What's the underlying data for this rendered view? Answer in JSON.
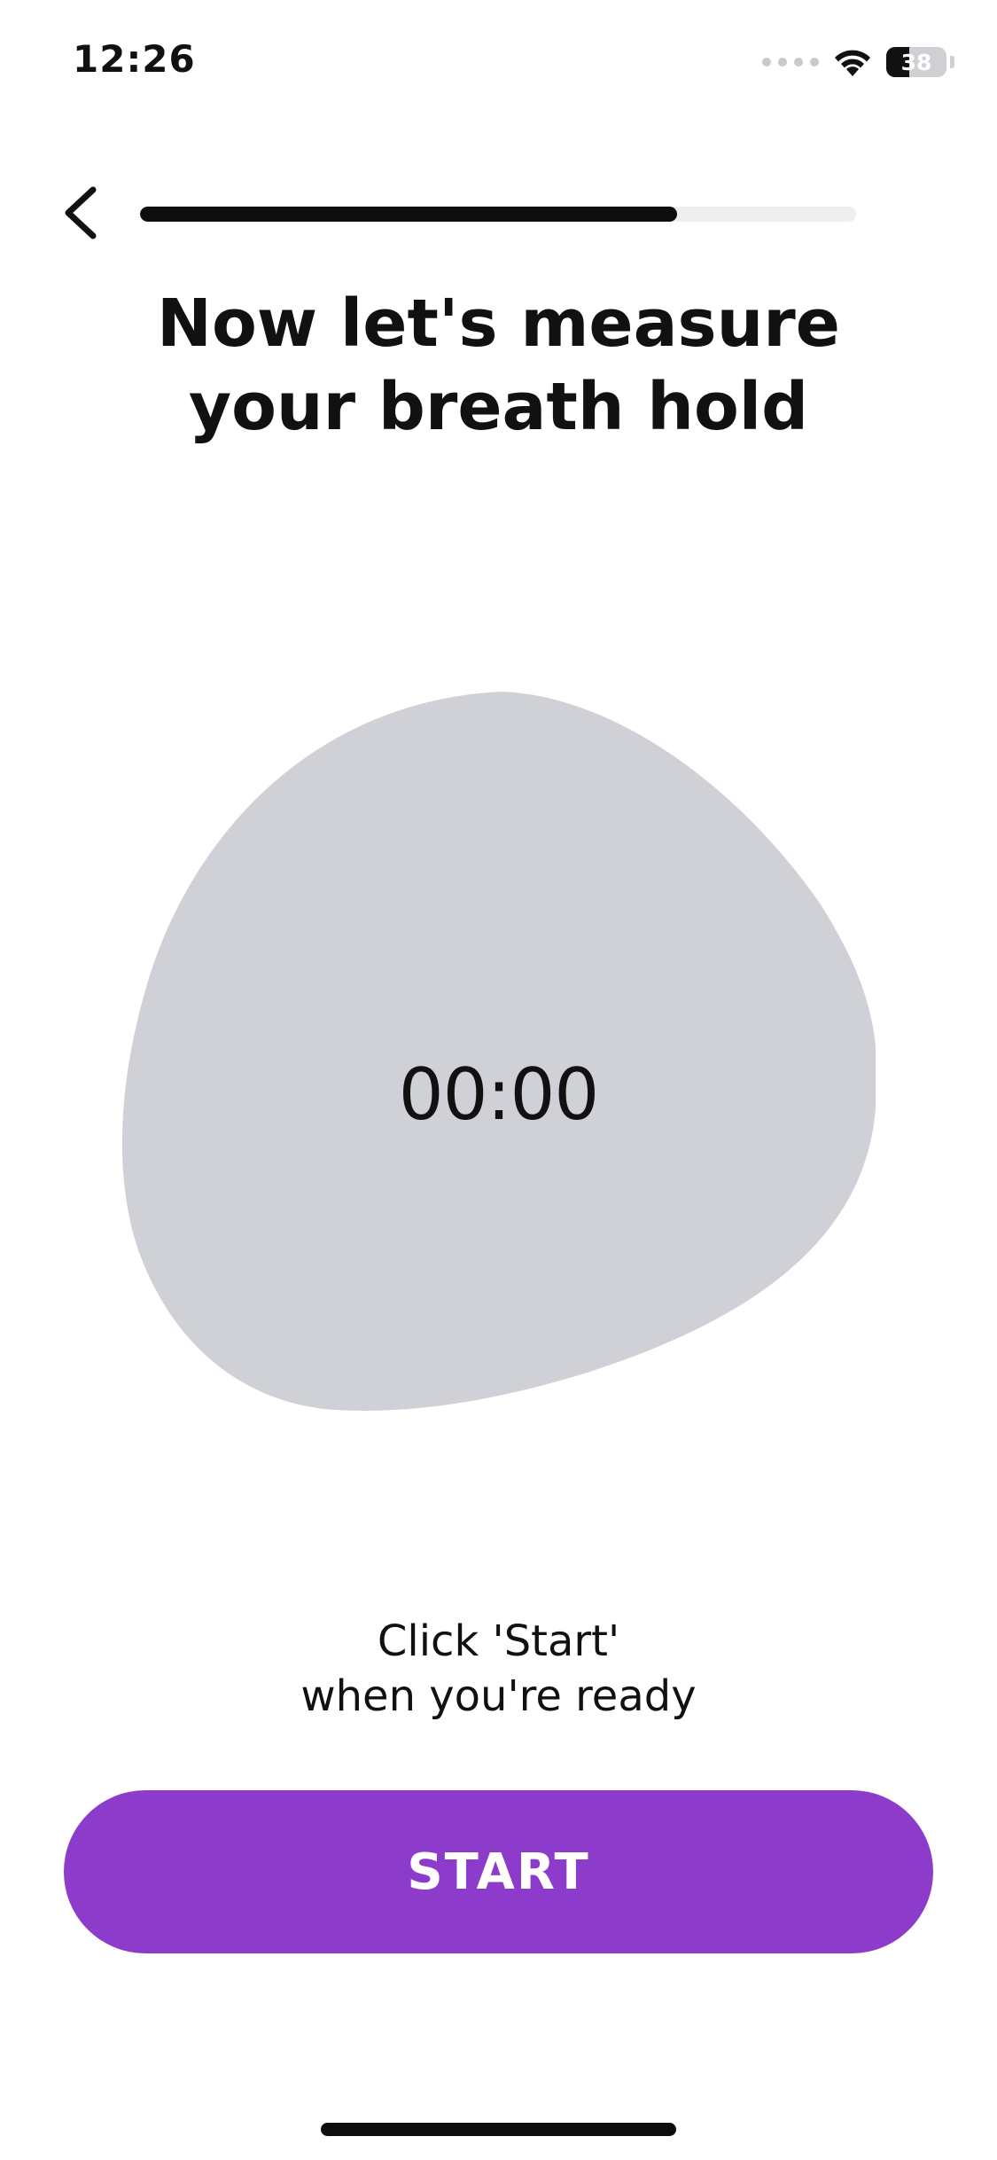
{
  "status_bar": {
    "time": "12:26",
    "battery_level": "38",
    "battery_fraction": 0.38,
    "icons": [
      "signal-dots-icon",
      "wifi-icon",
      "battery-icon"
    ]
  },
  "nav": {
    "back_icon": "chevron-left-icon",
    "progress_fraction": 0.75
  },
  "title": {
    "line1": "Now let's measure",
    "line2": "your breath hold"
  },
  "timer": {
    "value": "00:00"
  },
  "instruction": {
    "line1": "Click 'Start'",
    "line2": "when you're ready"
  },
  "start_button": {
    "label": "START"
  },
  "colors": {
    "accent": "#8c3bcb",
    "blob": "#d0d1d6",
    "progress_fill": "#0d0d0d",
    "progress_track": "#eeeeef"
  }
}
